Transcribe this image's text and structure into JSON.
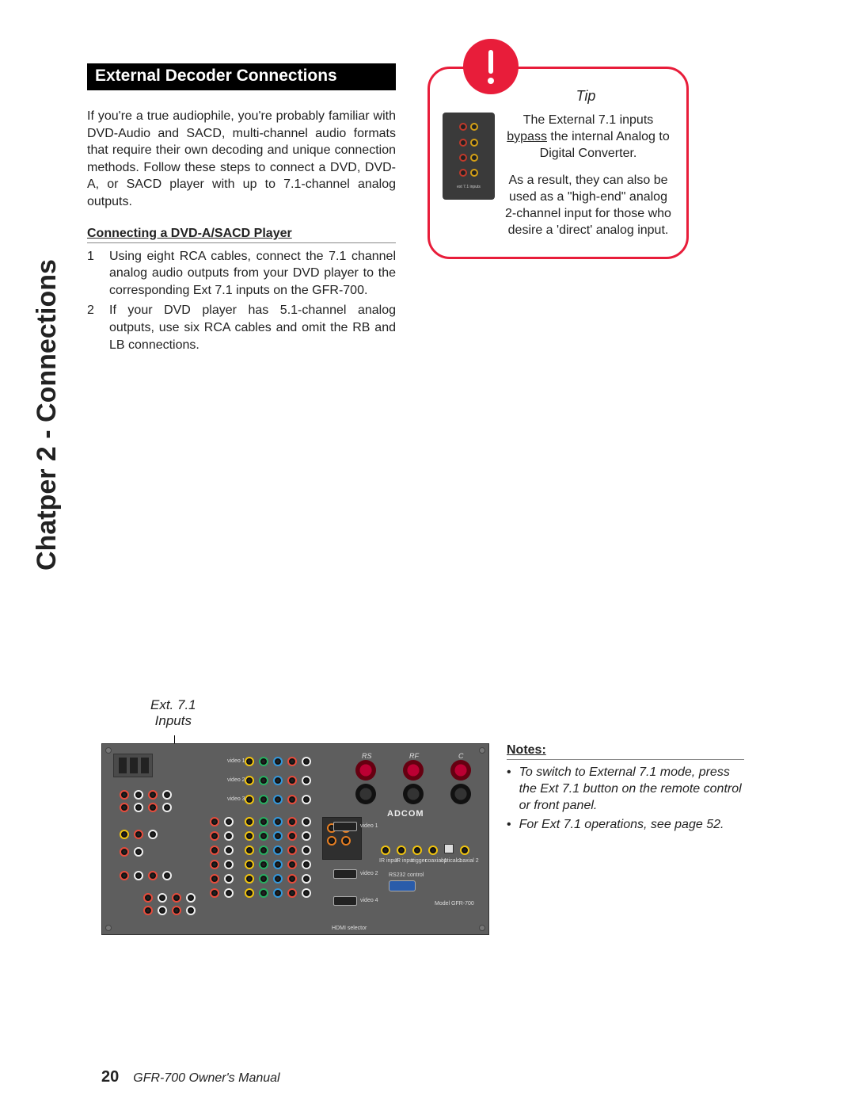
{
  "side_label": "Chatper 2 - Connections",
  "section_header": "External Decoder Connections",
  "intro": "If you're a true audiophile, you're probably familiar with DVD-Audio and SACD, multi-channel audio formats that require their own decoding and unique connection methods. Follow these steps to connect a DVD, DVD-A, or SACD player with up to 7.1-channel analog outputs.",
  "sub_head": "Connecting a DVD-A/SACD Player",
  "steps": [
    "Using eight RCA cables, connect the 7.1 channel analog audio outputs from your DVD player to the corresponding Ext 7.1 inputs on the GFR-700.",
    "If your DVD player has 5.1-channel analog outputs, use six RCA cables and omit the RB and LB connections."
  ],
  "tip": {
    "title": "Tip",
    "p1a": "The External 7.1 inputs ",
    "p1b": "bypass",
    "p1c": " the internal Analog to Digital Converter.",
    "p2": "As a result, they can also be used as a \"high-end\" analog 2-channel input for those who desire a 'direct' analog input.",
    "thumb_label": "ext 7.1 inputs"
  },
  "ext_label_l1": "Ext. 7.1",
  "ext_label_l2": "Inputs",
  "panel": {
    "logo": "ADCOM",
    "binding_labels": [
      "RS",
      "RF",
      "C"
    ],
    "video_labels": [
      "video 1",
      "video 2",
      "video 3",
      "video 4"
    ],
    "bottom_label": "HDMI selector",
    "model_label": "Model GFR-700",
    "rs232_label": "RS232 control",
    "small_labels": [
      "12v DC trigger",
      "IR input",
      "IR input",
      "trigger",
      "coaxial 1",
      "optical 1",
      "coaxial 2"
    ]
  },
  "notes": {
    "head": "Notes:",
    "items": [
      "To switch to External 7.1 mode, press the Ext 7.1 button on the remote control or front panel.",
      "For Ext 7.1 operations, see page 52."
    ]
  },
  "footer": {
    "page": "20",
    "text": "GFR-700 Owner's Manual"
  }
}
